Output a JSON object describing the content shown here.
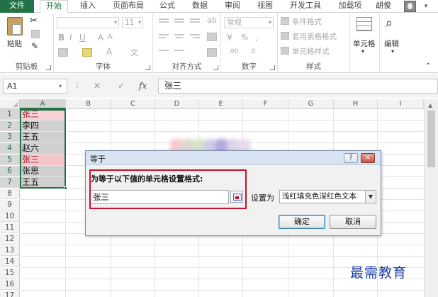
{
  "tabs": [
    {
      "label": "文件"
    },
    {
      "label": "开始"
    },
    {
      "label": "插入"
    },
    {
      "label": "页面布局"
    },
    {
      "label": "公式"
    },
    {
      "label": "数据"
    },
    {
      "label": "审阅"
    },
    {
      "label": "视图"
    },
    {
      "label": "开发工具"
    },
    {
      "label": "加载项"
    }
  ],
  "user": {
    "name": "胡俊"
  },
  "ribbon": {
    "clipboard": {
      "label": "剪贴板",
      "paste": "粘贴"
    },
    "font": {
      "label": "字体",
      "size": "11"
    },
    "alignment": {
      "label": "对齐方式"
    },
    "number": {
      "label": "数字",
      "format": "常规"
    },
    "styles": {
      "label": "样式",
      "conditional": "条件格式",
      "table": "套用表格格式",
      "cell_styles": "单元格样式"
    },
    "cells": {
      "label": "单元格"
    },
    "editing": {
      "label": "编辑"
    }
  },
  "formula_bar": {
    "name_box": "A1",
    "fx": "fx",
    "value": "张三"
  },
  "grid": {
    "columns": [
      "A",
      "B",
      "C",
      "D",
      "E",
      "F",
      "G",
      "H",
      "I"
    ],
    "rows": [
      "1",
      "2",
      "3",
      "4",
      "5",
      "6",
      "7",
      "8",
      "9",
      "10",
      "11",
      "12",
      "13",
      "14",
      "15",
      "16",
      "17"
    ],
    "cells": [
      {
        "text": "张三",
        "highlight": true
      },
      {
        "text": "李四",
        "highlight": false
      },
      {
        "text": "王五",
        "highlight": false
      },
      {
        "text": "赵六",
        "highlight": false
      },
      {
        "text": "张三",
        "highlight": true
      },
      {
        "text": "张思",
        "highlight": false
      },
      {
        "text": "王五",
        "highlight": false
      }
    ],
    "highlight_color": "#f4c6cc",
    "highlight_text_color": "#9c1c2a"
  },
  "dialog": {
    "title": "等于",
    "help": "?",
    "close": "×",
    "prompt": "为等于以下值的单元格设置格式:",
    "value": "张三",
    "format_label": "设置为",
    "format_value": "浅红填充色深红色文本",
    "ok": "确定",
    "cancel": "取消"
  },
  "watermark": "最需教育",
  "colors": {
    "accent": "#217346",
    "callout": "#c8132b",
    "watermark": "#1f3fa8"
  }
}
